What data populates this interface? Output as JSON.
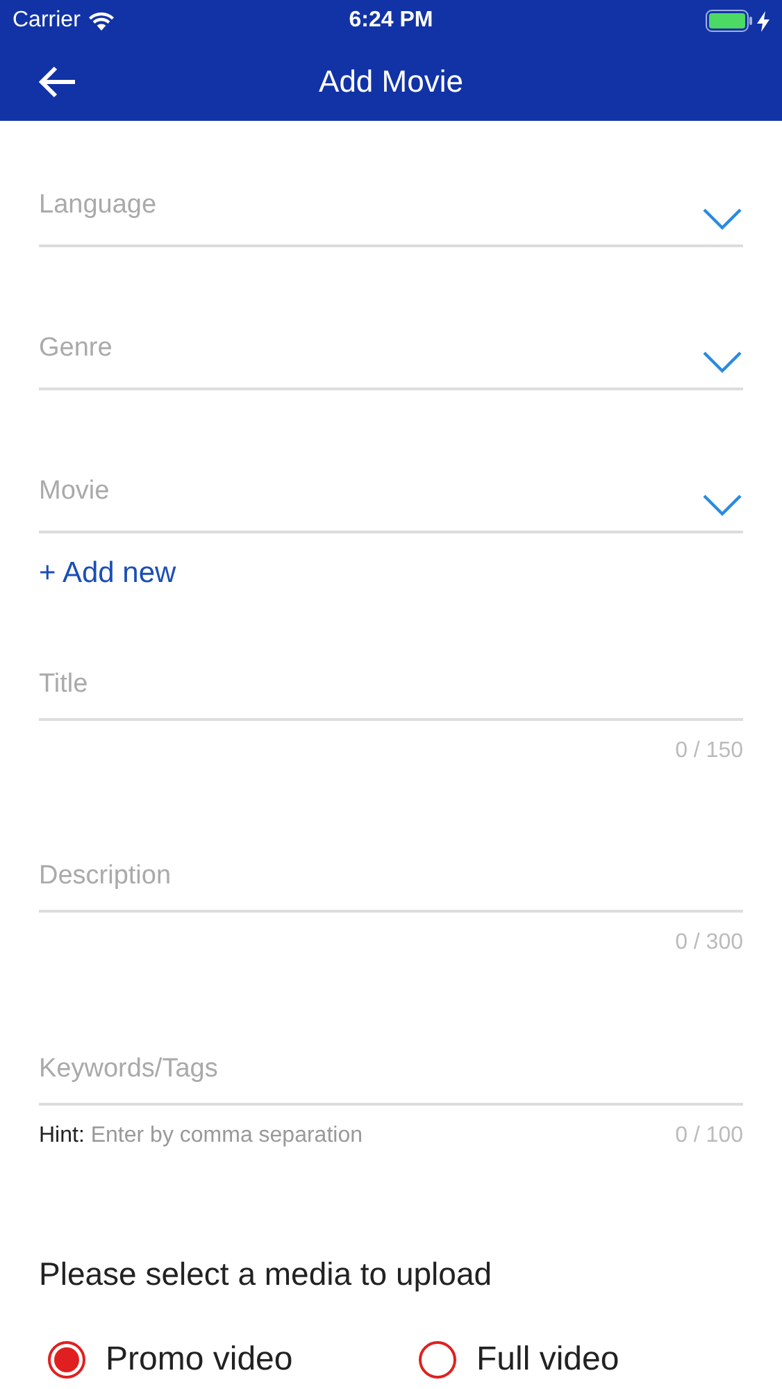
{
  "status_bar": {
    "carrier": "Carrier",
    "time": "6:24 PM"
  },
  "nav_bar": {
    "title": "Add Movie"
  },
  "dropdowns": [
    {
      "label": "Language"
    },
    {
      "label": "Genre"
    },
    {
      "label": "Movie"
    }
  ],
  "add_new_link": "+ Add new",
  "text_fields": [
    {
      "label": "Title",
      "counter": "0 / 150"
    },
    {
      "label": "Description",
      "counter": "0 / 300"
    },
    {
      "label": "Keywords/Tags",
      "counter": "0 / 100",
      "hint_label": "Hint:",
      "hint_text": "Enter by comma separation"
    }
  ],
  "media": {
    "heading": "Please select a media to upload",
    "options": [
      {
        "label": "Promo video",
        "selected": true
      },
      {
        "label": "Full video",
        "selected": false
      }
    ]
  }
}
